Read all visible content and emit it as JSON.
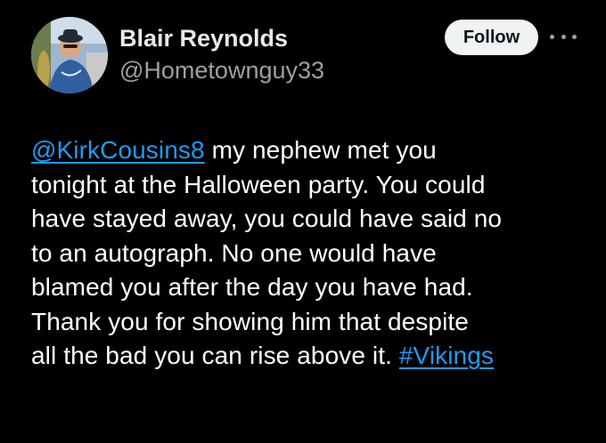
{
  "author": {
    "display_name": "Blair Reynolds",
    "handle": "@Hometownguy33"
  },
  "actions": {
    "follow_label": "Follow",
    "more_icon": "more-horizontal-icon"
  },
  "tweet": {
    "mention": "@KirkCousins8",
    "line1_rest": " my nephew met you",
    "line2": "tonight at the Halloween party. You could",
    "line3": "have stayed away, you could have said no",
    "line4": "to an autograph. No one would have",
    "line5": "blamed you after the day you have had.",
    "line6": "Thank you for showing him that despite",
    "line7_start": "all the bad you can rise above it. ",
    "hashtag": "#Vikings"
  },
  "colors": {
    "background": "#000000",
    "text": "#ffffff",
    "link": "#1d9bf0",
    "secondary": "#9aa0a6",
    "follow_bg": "#eff3f4"
  }
}
